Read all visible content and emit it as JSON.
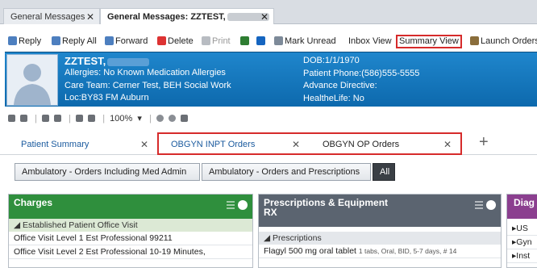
{
  "window_tabs": [
    {
      "label": "General Messages"
    },
    {
      "label": "General Messages: ZZTEST,"
    }
  ],
  "toolbar": {
    "reply": "Reply",
    "reply_all": "Reply All",
    "forward": "Forward",
    "delete": "Delete",
    "print": "Print",
    "mark_unread": "Mark Unread",
    "inbox_view": "Inbox View",
    "summary_view": "Summary View",
    "launch_orders": "Launch Orders"
  },
  "patient": {
    "name": "ZZTEST,",
    "allergies": "Allergies: No Known Medication Allergies",
    "care_team": "Care Team: Cerner Test, BEH Social Work",
    "location": "Loc:BY83 FM Auburn",
    "dob": "DOB:1/1/1970",
    "phone": "Patient Phone:(586)555-5555",
    "advance_directive": "Advance Directive:",
    "healthelife": "HealtheLife: No"
  },
  "view_toolbar": {
    "zoom": "100%"
  },
  "page_tabs": [
    {
      "label": "Patient Summary"
    },
    {
      "label": "OBGYN INPT Orders"
    },
    {
      "label": "OBGYN OP Orders"
    }
  ],
  "filters": [
    {
      "label": "Ambulatory - Orders Including Med Admin"
    },
    {
      "label": "Ambulatory - Orders and Prescriptions"
    },
    {
      "label": "All"
    }
  ],
  "components": {
    "charges": {
      "title": "Charges",
      "section": "Established Patient Office Visit",
      "rows": [
        "Office Visit Level 1 Est Professional 99211",
        "Office Visit Level 2 Est Professional 10-19 Minutes,"
      ]
    },
    "prescriptions": {
      "title_line1": "Prescriptions & Equipment",
      "title_line2": "RX",
      "section": "Prescriptions",
      "row_main": "Flagyl 500 mg oral tablet",
      "row_detail": "1 tabs, Oral, BID, 5-7 days, # 14"
    },
    "diag": {
      "title": "Diag",
      "rows": [
        "US",
        "Gyn",
        "Inst"
      ]
    }
  },
  "colors": {
    "banner": "#1478bf",
    "charges_header": "#2f8f3d",
    "prescriptions_header": "#5b6470",
    "diag_header": "#8b3f8f",
    "highlight": "#d62b2b"
  }
}
